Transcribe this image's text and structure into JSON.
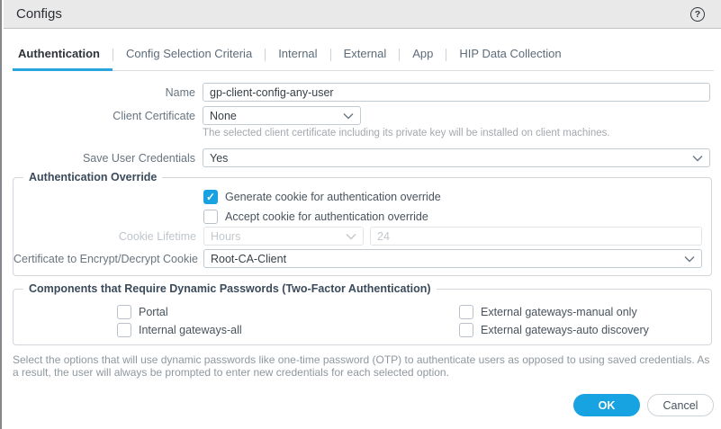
{
  "dialog": {
    "title": "Configs",
    "help_glyph": "?"
  },
  "tabs": [
    {
      "label": "Authentication",
      "active": true
    },
    {
      "label": "Config Selection Criteria",
      "active": false
    },
    {
      "label": "Internal",
      "active": false
    },
    {
      "label": "External",
      "active": false
    },
    {
      "label": "App",
      "active": false
    },
    {
      "label": "HIP Data Collection",
      "active": false
    }
  ],
  "form": {
    "name": {
      "label": "Name",
      "value": "gp-client-config-any-user"
    },
    "client_certificate": {
      "label": "Client Certificate",
      "value": "None",
      "help": "The selected client certificate including its private key will be installed on client machines."
    },
    "save_user_credentials": {
      "label": "Save User Credentials",
      "value": "Yes"
    }
  },
  "auth_override": {
    "legend": "Authentication Override",
    "generate_cookie": {
      "label": "Generate cookie for authentication override",
      "checked": true
    },
    "accept_cookie": {
      "label": "Accept cookie for authentication override",
      "checked": false
    },
    "cookie_lifetime": {
      "label": "Cookie Lifetime",
      "unit_value": "Hours",
      "amount_value": "24",
      "disabled": true
    },
    "cert_cookie": {
      "label": "Certificate to Encrypt/Decrypt Cookie",
      "value": "Root-CA-Client"
    }
  },
  "components": {
    "legend": "Components that Require Dynamic Passwords (Two-Factor Authentication)",
    "options": [
      {
        "label": "Portal",
        "checked": false
      },
      {
        "label": "External gateways-manual only",
        "checked": false
      },
      {
        "label": "Internal gateways-all",
        "checked": false
      },
      {
        "label": "External gateways-auto discovery",
        "checked": false
      }
    ]
  },
  "footer_note": "Select the options that will use dynamic passwords like one-time password (OTP) to authenticate users as opposed to using saved credentials. As a result, the user will always be prompted to enter new credentials for each selected option.",
  "buttons": {
    "ok": "OK",
    "cancel": "Cancel"
  },
  "colors": {
    "accent_blue": "#17a3e2",
    "titlebar_bg": "#e9e9ea",
    "label_gray": "#68747f"
  }
}
